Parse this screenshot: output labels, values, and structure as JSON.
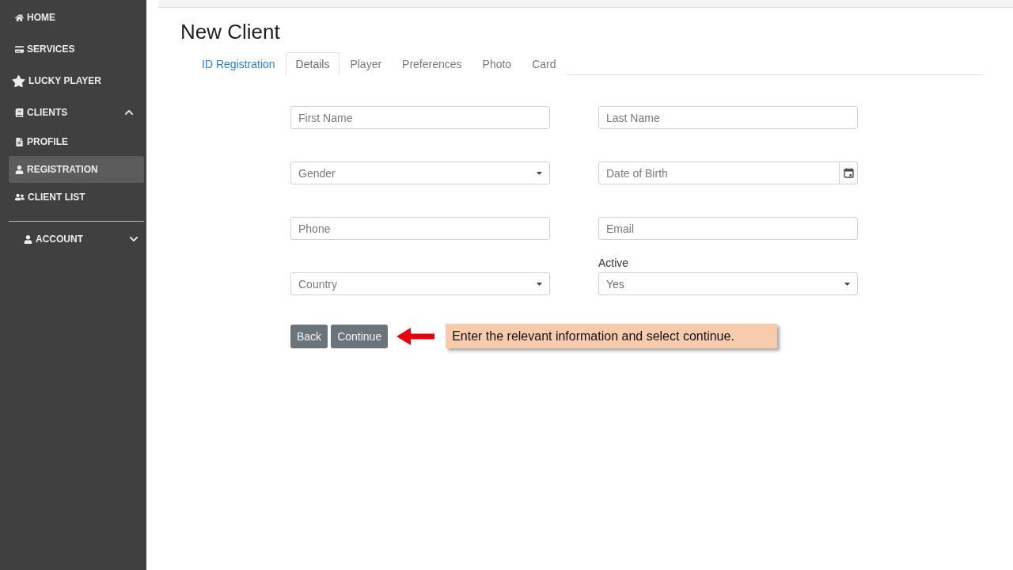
{
  "sidebar": {
    "items": [
      {
        "kind": "link",
        "label": "HOME",
        "selected": false
      },
      {
        "kind": "link",
        "label": "SERVICES",
        "selected": false
      },
      {
        "kind": "link",
        "label": "LUCKY PLAYER",
        "selected": false
      },
      {
        "kind": "group",
        "label": "CLIENTS",
        "selected": false,
        "expanded": true,
        "children": [
          {
            "label": "PROFILE",
            "selected": false
          },
          {
            "label": "REGISTRATION",
            "selected": true
          },
          {
            "label": "CLIENT LIST",
            "selected": false
          }
        ]
      }
    ],
    "account": {
      "kind": "group",
      "label": "ACCOUNT",
      "selected": false,
      "expanded": false
    }
  },
  "page": {
    "title": "New Client"
  },
  "tabs": [
    {
      "label": "ID Registration",
      "selected": false,
      "disabled": false
    },
    {
      "label": "Details",
      "selected": true,
      "disabled": false
    },
    {
      "label": "Player",
      "selected": false,
      "disabled": true
    },
    {
      "label": "Preferences",
      "selected": false,
      "disabled": true
    },
    {
      "label": "Photo",
      "selected": false,
      "disabled": true
    },
    {
      "label": "Card",
      "selected": false,
      "disabled": true
    }
  ],
  "form": {
    "fields": [
      {
        "kind": "text",
        "placeholder": "First Name"
      },
      {
        "kind": "text",
        "placeholder": "Last Name"
      },
      {
        "kind": "select",
        "placeholder": "Gender"
      },
      {
        "kind": "date",
        "placeholder": "Date of Birth"
      },
      {
        "kind": "text",
        "placeholder": "Phone"
      },
      {
        "kind": "text",
        "placeholder": "Email"
      },
      {
        "kind": "select",
        "placeholder": "Country"
      },
      {
        "kind": "select",
        "label": "Active",
        "value": "Yes"
      }
    ],
    "buttons": [
      {
        "label": "Back"
      },
      {
        "label": "Continue"
      }
    ]
  },
  "callout": {
    "text": "Enter the relevant information and select continue."
  }
}
